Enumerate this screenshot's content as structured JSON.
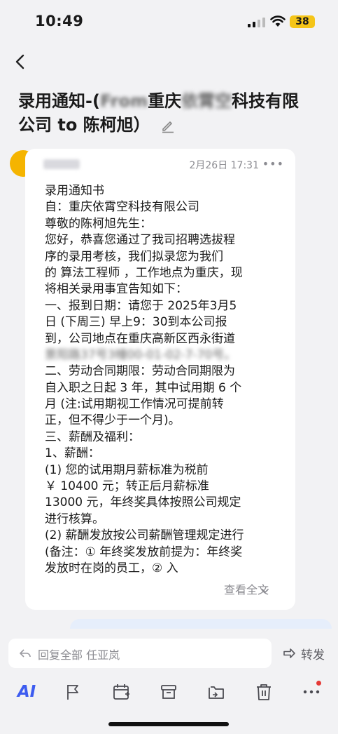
{
  "status_bar": {
    "time": "10:49",
    "battery": "38"
  },
  "email": {
    "subject_prefix": "录用通知-(",
    "subject_blur_1": "From",
    "subject_mid": "重庆",
    "subject_blur_2": "依霄空",
    "subject_suffix": "科技有限",
    "subject_line2": "公司 to 陈柯旭）",
    "date": "2月26日 17:31",
    "view_all": "查看全文",
    "body_lines": [
      "录用通知书",
      "自：重庆依霄空科技有限公司",
      "尊敬的陈柯旭先生：",
      "您好，恭喜您通过了我司招聘选拔程",
      "序的录用考核，我们拟录您为我们",
      "的 算法工程师 ，工作地点为重庆，现",
      "将相关录用事宜告知如下：",
      "一、报到日期：请您于 2025年3月5",
      "日 (下周三) 早上9：30到本公司报",
      "到，公司地点在重庆高新区西永街道",
      "景阳路37号3幢00-01-02-7-70号。",
      "二、劳动合同期限：劳动合同期限为",
      "自入职之日起 3 年，其中试用期 6 个",
      "月 (注:试用期视工作情况可提前转",
      "正，但不得少于一个月)。",
      "三、薪酬及福利：",
      "1、薪酬：",
      "(1) 您的试用期月薪标准为税前",
      " ￥ 10400 元；转正后月薪标准",
      " 13000 元，年终奖具体按照公司规定",
      "进行核算。",
      "(2) 薪酬发放按公司薪酬管理规定进行",
      "(备注：① 年终奖发放前提为：年终奖",
      "发放时在岗的员工，② 入"
    ]
  },
  "reply": {
    "placeholder": "回复全部  任亚岚",
    "forward": "转发"
  },
  "toolbar": {
    "ai": "AI"
  },
  "colors": {
    "accent": "#3d5cf0",
    "avatar": "#f5b400",
    "battery": "#f5c518"
  }
}
